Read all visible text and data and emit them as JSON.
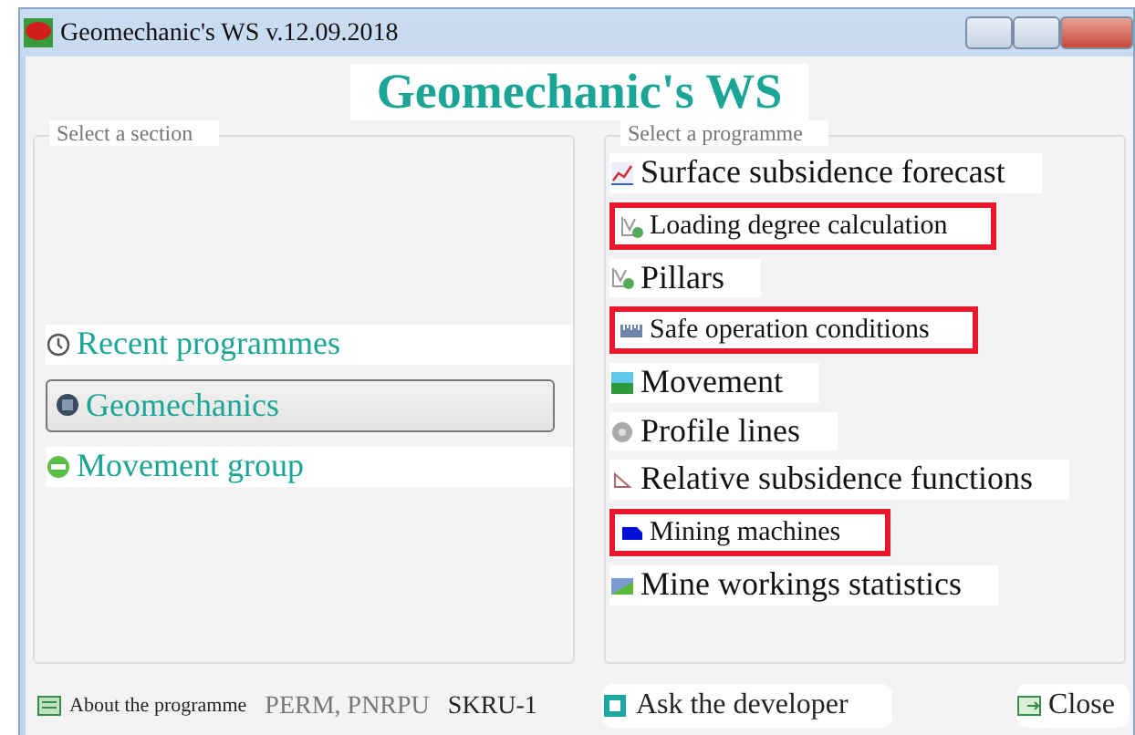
{
  "window": {
    "title": "Geomechanic's WS v.12.09.2018"
  },
  "heading": "Geomechanic's WS",
  "sections": {
    "title": "Select a section",
    "items": [
      {
        "label": "Recent programmes",
        "selected": false
      },
      {
        "label": "Geomechanics",
        "selected": true
      },
      {
        "label": "Movement group",
        "selected": false
      }
    ]
  },
  "programmes": {
    "title": "Select a programme",
    "items": [
      {
        "label": "Surface subsidence forecast",
        "highlighted": false
      },
      {
        "label": "Loading degree calculation",
        "highlighted": true
      },
      {
        "label": "Pillars",
        "highlighted": false
      },
      {
        "label": "Safe operation conditions",
        "highlighted": true
      },
      {
        "label": "Movement",
        "highlighted": false
      },
      {
        "label": "Profile lines",
        "highlighted": false
      },
      {
        "label": "Relative subsidence functions",
        "highlighted": false
      },
      {
        "label": "Mining machines",
        "highlighted": true
      },
      {
        "label": "Mine workings statistics",
        "highlighted": false
      }
    ]
  },
  "status_bar": {
    "about": "About the programme",
    "org": "PERM, PNRPU",
    "code": "SKRU-1",
    "ask": "Ask the developer",
    "close": "Close"
  }
}
